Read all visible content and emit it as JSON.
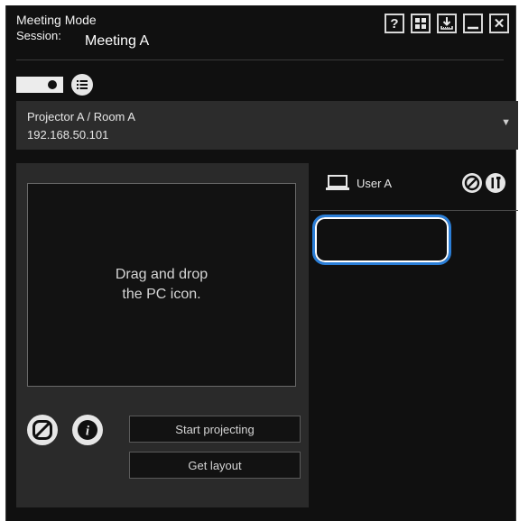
{
  "window": {
    "title": "Meeting Mode",
    "session_label": "Session:",
    "session_name": "Meeting A"
  },
  "titlebar_buttons": [
    {
      "name": "help-icon",
      "glyph": "?"
    },
    {
      "name": "grid-icon",
      "glyph": ""
    },
    {
      "name": "download-icon",
      "glyph": ""
    },
    {
      "name": "minimize-icon",
      "glyph": ""
    },
    {
      "name": "close-icon",
      "glyph": "✕"
    }
  ],
  "projector": {
    "selected_line1": "Projector A / Room A",
    "selected_line2": "192.168.50.101"
  },
  "dropzone": {
    "line1": "Drag and drop",
    "line2": "the PC icon."
  },
  "buttons": {
    "start_projecting": "Start projecting",
    "get_layout": "Get layout"
  },
  "user": {
    "label": "User A"
  }
}
